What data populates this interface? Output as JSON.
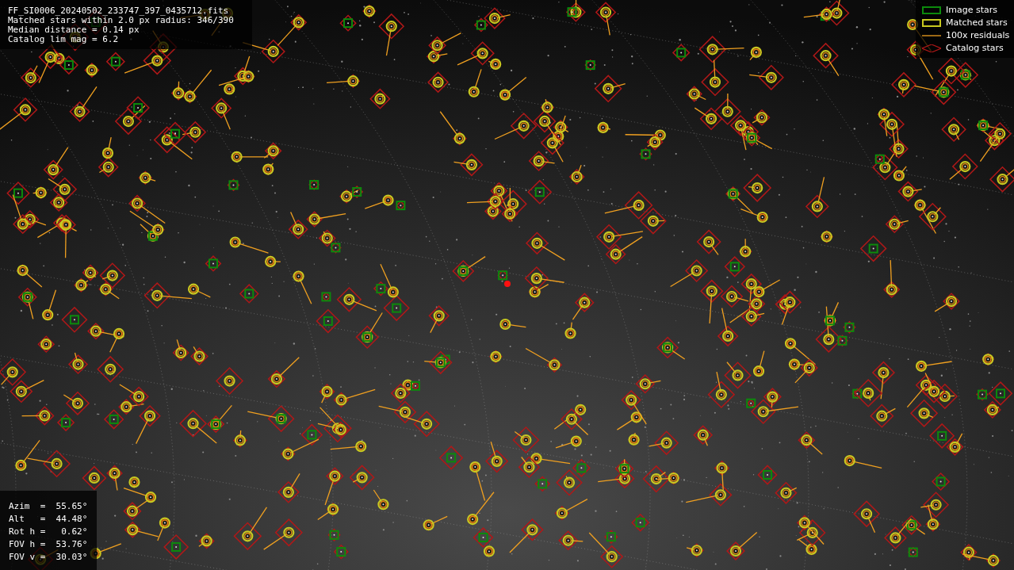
{
  "header": {
    "lines": [
      "FF_SI0006_20240502_233747_397_0435712.fits",
      "Matched stars within 2.0 px radius: 346/390",
      "Median distance = 0.14 px",
      "Catalog lim mag = 6.2"
    ]
  },
  "legend": [
    {
      "kind": "image",
      "label": "Image stars"
    },
    {
      "kind": "matched",
      "label": "Matched stars"
    },
    {
      "kind": "residual",
      "label": "100x residuals"
    },
    {
      "kind": "catalog",
      "label": "Catalog stars"
    }
  ],
  "pointing": {
    "lines": [
      "Azim  =  55.65°",
      "Alt   =  44.48°",
      "Rot h =   0.62°",
      "FOV h =  53.76°",
      "FOV v =  30.03°"
    ]
  }
}
